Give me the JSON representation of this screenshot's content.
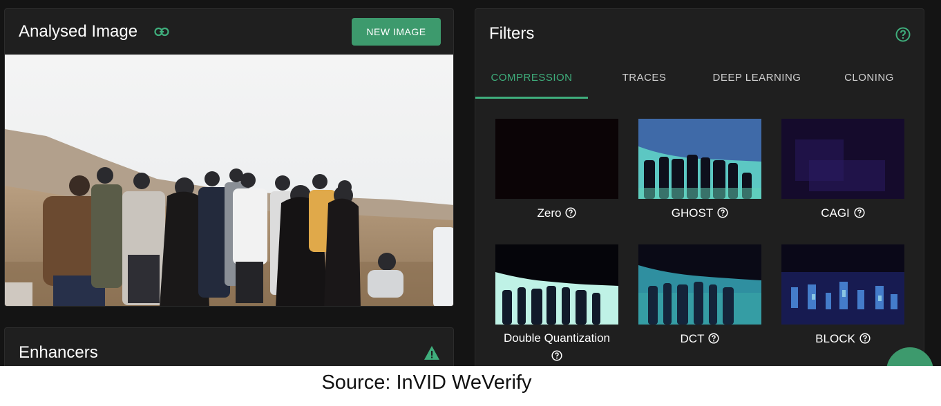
{
  "analysed": {
    "title": "Analysed Image",
    "link_icon": "link-icon",
    "new_image_label": "NEW IMAGE"
  },
  "enhancers": {
    "title": "Enhancers",
    "warning_icon": "warning-triangle-icon"
  },
  "filters": {
    "title": "Filters",
    "help_icon": "help-circle-icon",
    "tabs": [
      {
        "label": "COMPRESSION",
        "active": true
      },
      {
        "label": "TRACES",
        "active": false
      },
      {
        "label": "DEEP LEARNING",
        "active": false
      },
      {
        "label": "CLONING",
        "active": false
      }
    ],
    "items": [
      {
        "label": "Zero"
      },
      {
        "label": "GHOST"
      },
      {
        "label": "CAGI"
      },
      {
        "label": "Double Quantization"
      },
      {
        "label": "DCT"
      },
      {
        "label": "BLOCK"
      }
    ]
  },
  "colors": {
    "accent": "#3d9a6d",
    "accent_text": "#3fae7c",
    "background": "#141414",
    "panel": "#1f1f1f"
  },
  "caption": "Source: InVID WeVerify"
}
